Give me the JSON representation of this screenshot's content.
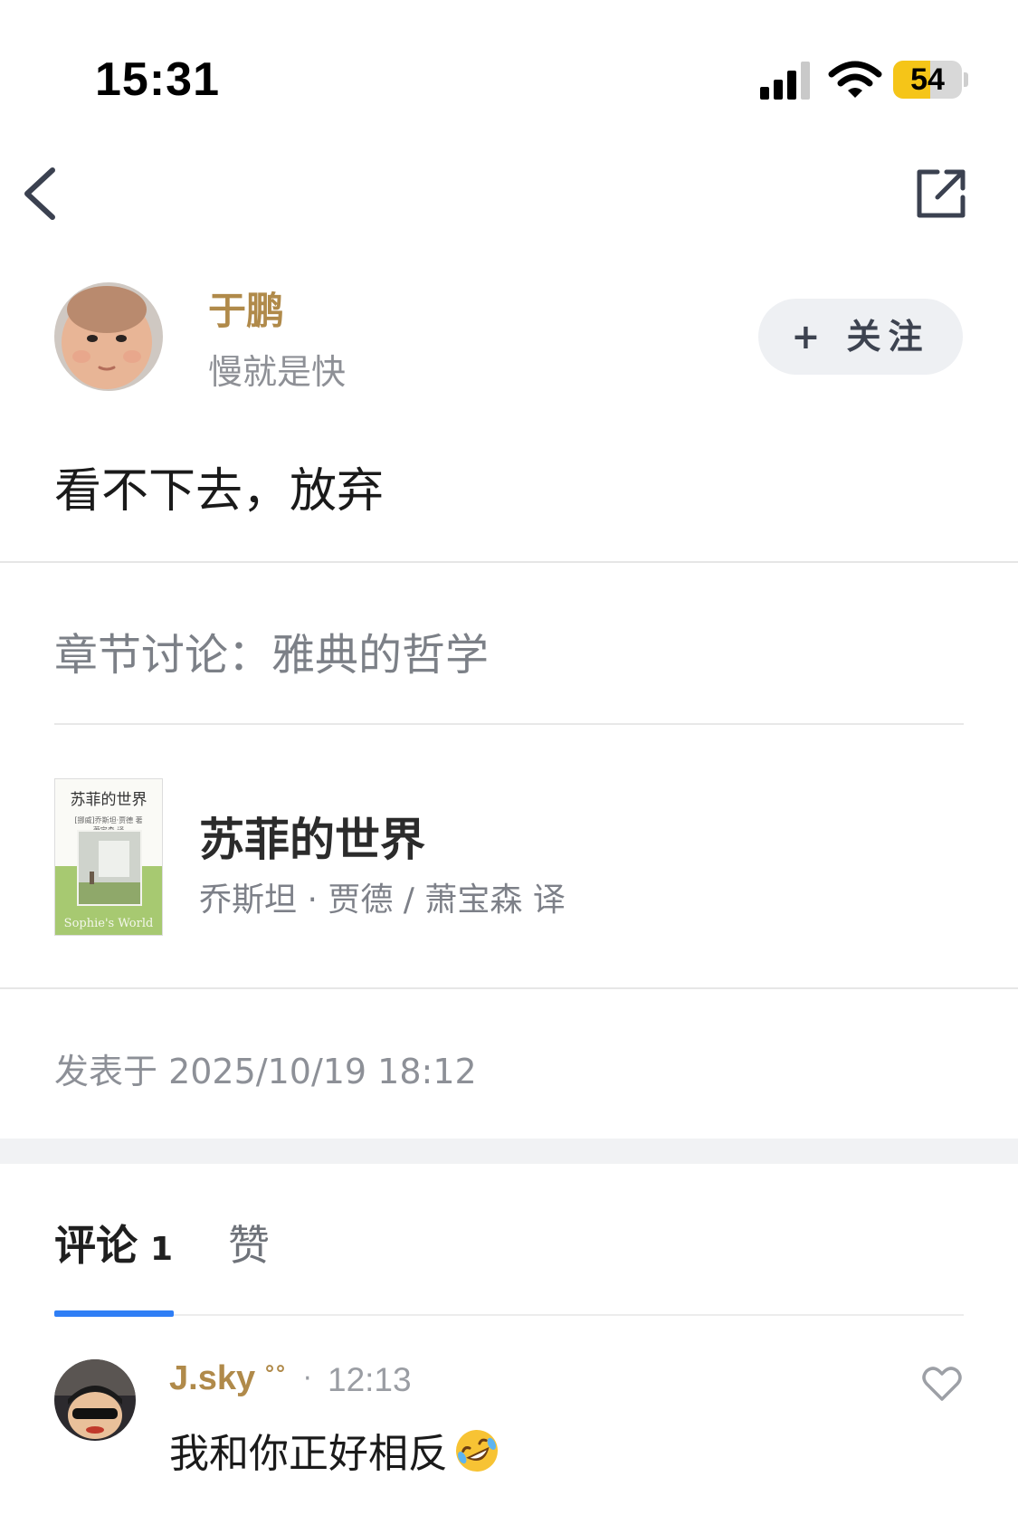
{
  "status_bar": {
    "time": "15:31",
    "battery": "54",
    "battery_level": 0.54,
    "battery_color": "#f5c518"
  },
  "nav": {
    "back_icon": "chevron-left-icon",
    "share_icon": "external-share-icon"
  },
  "author": {
    "name": "于鹏",
    "signature": "慢就是快",
    "follow_label": "+ 关注"
  },
  "post": {
    "text": "看不下去，放弃",
    "chapter": "章节讨论：雅典的哲学",
    "posted_at": "发表于 2025/10/19 18:12"
  },
  "book": {
    "title": "苏菲的世界",
    "author_line": "乔斯坦 · 贾德 / 萧宝森 译",
    "cover": {
      "title": "苏菲的世界",
      "authors_line1": "[挪威]乔斯坦·贾德 著",
      "authors_line2": "萧宝森 译",
      "english_title": "Sophie's World"
    }
  },
  "tabs": {
    "comments_label": "评论",
    "comments_count": "1",
    "likes_label": "赞",
    "active_color": "#2f7ef5"
  },
  "comments": [
    {
      "user": "J.sky",
      "badge": "°°",
      "separator": "·",
      "time": "12:13",
      "text": "我和你正好相反",
      "emoji_icon": "rolling-laughing-emoji-icon",
      "like_icon": "heart-outline-icon"
    }
  ],
  "colors": {
    "accent_gold": "#b08a4a",
    "muted_text": "#8e9096"
  }
}
